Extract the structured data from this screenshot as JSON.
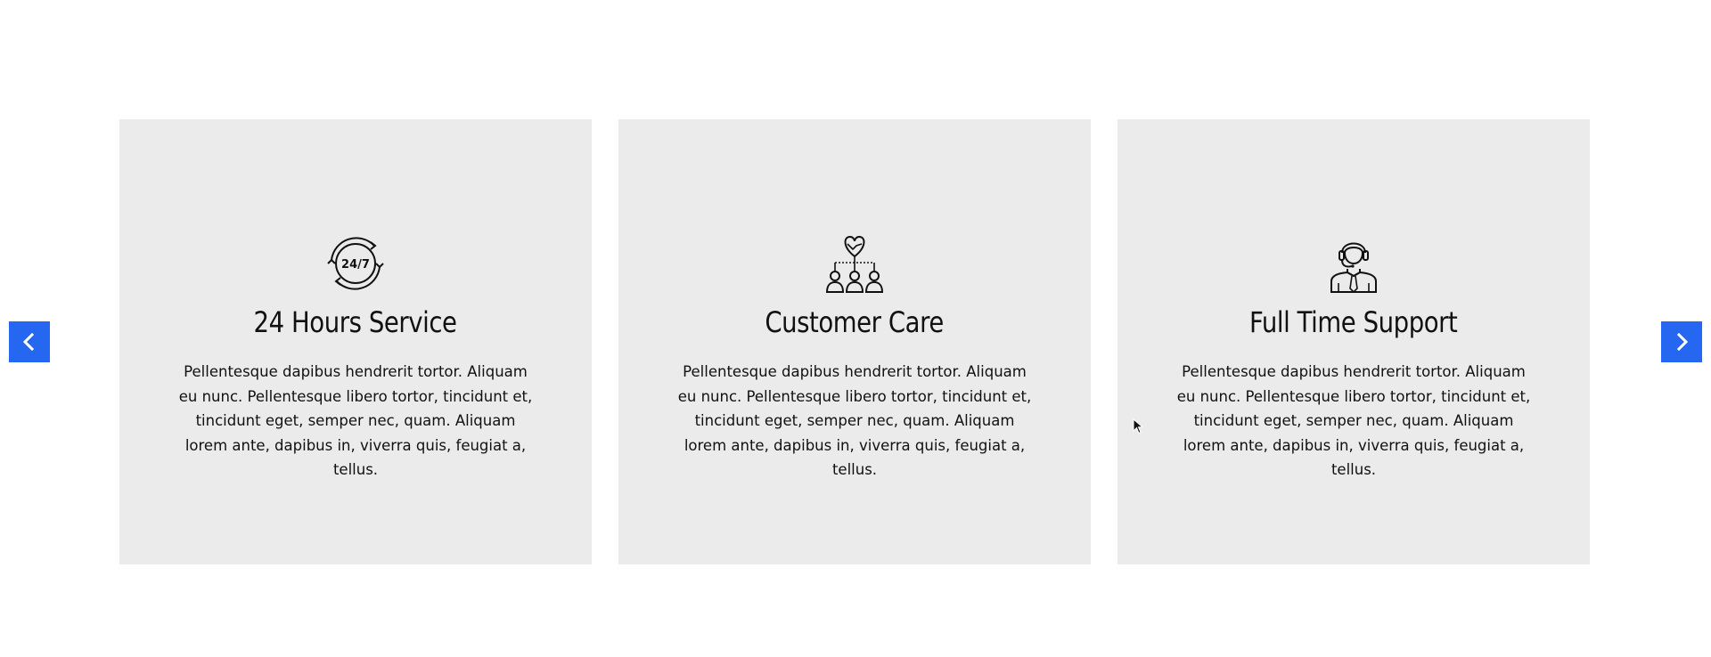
{
  "carousel": {
    "prev_icon": "chevron-left-icon",
    "next_icon": "chevron-right-icon",
    "accent_color": "#2567f0",
    "card_background": "#ebebeb",
    "cards": [
      {
        "icon": "clock-24-7-icon",
        "icon_label": "24/7",
        "title": "24 Hours Service",
        "text": "Pellentesque dapibus hendrerit tortor. Aliquam eu nunc. Pellentesque libero tortor, tincidunt et, tincidunt eget, semper nec, quam. Aliquam lorem ante, dapibus in, viverra quis, feugiat a, tellus."
      },
      {
        "icon": "customer-care-handshake-icon",
        "title": "Customer Care",
        "text": "Pellentesque dapibus hendrerit tortor. Aliquam eu nunc. Pellentesque libero tortor, tincidunt et, tincidunt eget, semper nec, quam. Aliquam lorem ante, dapibus in, viverra quis, feugiat a, tellus."
      },
      {
        "icon": "support-agent-headset-icon",
        "title": "Full Time Support",
        "text": "Pellentesque dapibus hendrerit tortor. Aliquam eu nunc. Pellentesque libero tortor, tincidunt et, tincidunt eget, semper nec, quam. Aliquam lorem ante, dapibus in, viverra quis, feugiat a, tellus."
      }
    ]
  }
}
